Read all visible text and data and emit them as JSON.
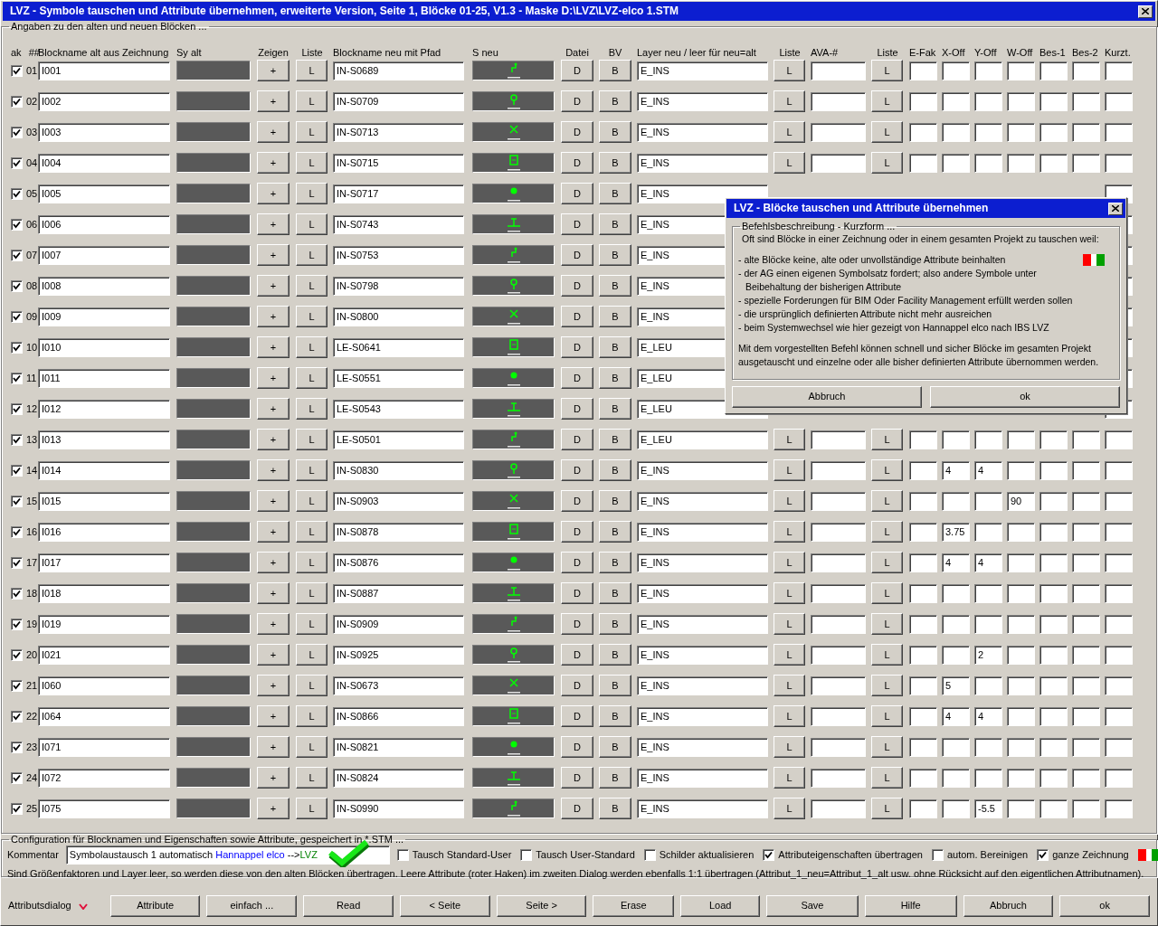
{
  "window": {
    "title": "LVZ - Symbole tauschen und Attribute übernehmen, erweiterte Version, Seite 1, Blöcke 01-25, V1.3 - Maske D:\\LVZ\\LVZ-elco 1.STM"
  },
  "blocks": {
    "legend": "Angaben zu den alten und neuen Blöcken ...",
    "columns": [
      "ak",
      "##",
      "Blockname alt aus Zeichnung",
      "Sy alt",
      "Zeigen",
      "Liste",
      "Blockname neu mit Pfad",
      "S neu",
      "Datei",
      "BV",
      "Layer neu / leer für neu=alt",
      "Liste",
      "AVA-#",
      "Liste",
      "E-Fak",
      "X-Off",
      "Y-Off",
      "W-Off",
      "Bes-1",
      "Bes-2",
      "Kurzt."
    ],
    "rows": [
      {
        "checked": true,
        "number": "01",
        "old_name": "I001",
        "show": "+",
        "list": "L",
        "new_name": "IN-S0689",
        "file": "D",
        "bv": "B",
        "layer": "E_INS",
        "layer_list": "L",
        "ava_list": "L"
      },
      {
        "checked": true,
        "number": "02",
        "old_name": "I002",
        "show": "+",
        "list": "L",
        "new_name": "IN-S0709",
        "file": "D",
        "bv": "B",
        "layer": "E_INS",
        "layer_list": "L",
        "ava_list": "L"
      },
      {
        "checked": true,
        "number": "03",
        "old_name": "I003",
        "show": "+",
        "list": "L",
        "new_name": "IN-S0713",
        "file": "D",
        "bv": "B",
        "layer": "E_INS",
        "layer_list": "L",
        "ava_list": "L"
      },
      {
        "checked": true,
        "number": "04",
        "old_name": "I004",
        "show": "+",
        "list": "L",
        "new_name": "IN-S0715",
        "file": "D",
        "bv": "B",
        "layer": "E_INS",
        "layer_list": "L",
        "ava_list": "L"
      },
      {
        "checked": true,
        "number": "05",
        "old_name": "I005",
        "show": "+",
        "list": "L",
        "new_name": "IN-S0717",
        "file": "D",
        "bv": "B",
        "layer": "E_INS"
      },
      {
        "checked": true,
        "number": "06",
        "old_name": "I006",
        "show": "+",
        "list": "L",
        "new_name": "IN-S0743",
        "file": "D",
        "bv": "B",
        "layer": "E_INS"
      },
      {
        "checked": true,
        "number": "07",
        "old_name": "I007",
        "show": "+",
        "list": "L",
        "new_name": "IN-S0753",
        "file": "D",
        "bv": "B",
        "layer": "E_INS"
      },
      {
        "checked": true,
        "number": "08",
        "old_name": "I008",
        "show": "+",
        "list": "L",
        "new_name": "IN-S0798",
        "file": "D",
        "bv": "B",
        "layer": "E_INS"
      },
      {
        "checked": true,
        "number": "09",
        "old_name": "I009",
        "show": "+",
        "list": "L",
        "new_name": "IN-S0800",
        "file": "D",
        "bv": "B",
        "layer": "E_INS"
      },
      {
        "checked": true,
        "number": "10",
        "old_name": "I010",
        "show": "+",
        "list": "L",
        "new_name": "LE-S0641",
        "file": "D",
        "bv": "B",
        "layer": "E_LEU"
      },
      {
        "checked": true,
        "number": "11",
        "old_name": "I011",
        "show": "+",
        "list": "L",
        "new_name": "LE-S0551",
        "file": "D",
        "bv": "B",
        "layer": "E_LEU"
      },
      {
        "checked": true,
        "number": "12",
        "old_name": "I012",
        "show": "+",
        "list": "L",
        "new_name": "LE-S0543",
        "file": "D",
        "bv": "B",
        "layer": "E_LEU"
      },
      {
        "checked": true,
        "number": "13",
        "old_name": "I013",
        "show": "+",
        "list": "L",
        "new_name": "LE-S0501",
        "file": "D",
        "bv": "B",
        "layer": "E_LEU",
        "layer_list": "L",
        "ava_list": "L"
      },
      {
        "checked": true,
        "number": "14",
        "old_name": "I014",
        "show": "+",
        "list": "L",
        "new_name": "IN-S0830",
        "file": "D",
        "bv": "B",
        "layer": "E_INS",
        "layer_list": "L",
        "ava_list": "L",
        "x_off": "4",
        "y_off": "4"
      },
      {
        "checked": true,
        "number": "15",
        "old_name": "I015",
        "show": "+",
        "list": "L",
        "new_name": "IN-S0903",
        "file": "D",
        "bv": "B",
        "layer": "E_INS",
        "layer_list": "L",
        "ava_list": "L",
        "w_off": "90"
      },
      {
        "checked": true,
        "number": "16",
        "old_name": "I016",
        "show": "+",
        "list": "L",
        "new_name": "IN-S0878",
        "file": "D",
        "bv": "B",
        "layer": "E_INS",
        "layer_list": "L",
        "ava_list": "L",
        "x_off": "3.75"
      },
      {
        "checked": true,
        "number": "17",
        "old_name": "I017",
        "show": "+",
        "list": "L",
        "new_name": "IN-S0876",
        "file": "D",
        "bv": "B",
        "layer": "E_INS",
        "layer_list": "L",
        "ava_list": "L",
        "x_off": "4",
        "y_off": "4"
      },
      {
        "checked": true,
        "number": "18",
        "old_name": "I018",
        "show": "+",
        "list": "L",
        "new_name": "IN-S0887",
        "file": "D",
        "bv": "B",
        "layer": "E_INS",
        "layer_list": "L",
        "ava_list": "L"
      },
      {
        "checked": true,
        "number": "19",
        "old_name": "I019",
        "show": "+",
        "list": "L",
        "new_name": "IN-S0909",
        "file": "D",
        "bv": "B",
        "layer": "E_INS",
        "layer_list": "L",
        "ava_list": "L"
      },
      {
        "checked": true,
        "number": "20",
        "old_name": "I021",
        "show": "+",
        "list": "L",
        "new_name": "IN-S0925",
        "file": "D",
        "bv": "B",
        "layer": "E_INS",
        "layer_list": "L",
        "ava_list": "L",
        "y_off": "2"
      },
      {
        "checked": true,
        "number": "21",
        "old_name": "I060",
        "show": "+",
        "list": "L",
        "new_name": "IN-S0673",
        "file": "D",
        "bv": "B",
        "layer": "E_INS",
        "layer_list": "L",
        "ava_list": "L",
        "x_off": "5"
      },
      {
        "checked": true,
        "number": "22",
        "old_name": "I064",
        "show": "+",
        "list": "L",
        "new_name": "IN-S0866",
        "file": "D",
        "bv": "B",
        "layer": "E_INS",
        "layer_list": "L",
        "ava_list": "L",
        "x_off": "4",
        "y_off": "4"
      },
      {
        "checked": true,
        "number": "23",
        "old_name": "I071",
        "show": "+",
        "list": "L",
        "new_name": "IN-S0821",
        "file": "D",
        "bv": "B",
        "layer": "E_INS",
        "layer_list": "L",
        "ava_list": "L"
      },
      {
        "checked": true,
        "number": "24",
        "old_name": "I072",
        "show": "+",
        "list": "L",
        "new_name": "IN-S0824",
        "file": "D",
        "bv": "B",
        "layer": "E_INS",
        "layer_list": "L",
        "ava_list": "L"
      },
      {
        "checked": true,
        "number": "25",
        "old_name": "I075",
        "show": "+",
        "list": "L",
        "new_name": "IN-S0990",
        "file": "D",
        "bv": "B",
        "layer": "E_INS",
        "layer_list": "L",
        "ava_list": "L",
        "y_off": "-5.5"
      }
    ]
  },
  "config": {
    "legend": "Configuration für Blocknamen und Eigenschaften sowie Attribute, gespeichert in *.STM ...",
    "comment_label": "Kommentar",
    "comment": [
      {
        "text": "Symbolaustausch 1 automatisch "
      },
      {
        "text": "Hannappel elco",
        "color": "#0000ff"
      },
      {
        "text": " -->"
      },
      {
        "text": "LVZ",
        "color": "#008000"
      }
    ],
    "options": [
      {
        "label": "Tausch Standard-User",
        "checked": false
      },
      {
        "label": "Tausch User-Standard",
        "checked": false
      },
      {
        "label": "Schilder aktualisieren",
        "checked": false
      },
      {
        "label": "Attributeigenschaften übertragen",
        "checked": true
      },
      {
        "label": "autom. Bereinigen",
        "checked": false
      },
      {
        "label": "ganze Zeichnung",
        "checked": true
      }
    ],
    "note": "Sind Größenfaktoren und Layer leer, so werden diese von den alten Blöcken übertragen. Leere Attribute (roter Haken) im zweiten Dialog werden ebenfalls 1:1 übertragen (Attribut_1_neu=Attribut_1_alt usw. ohne Rücksicht auf den eigentlichen Attributnamen)."
  },
  "footer": {
    "label": "Attributsdialog",
    "buttons": [
      "Attribute",
      "einfach ...",
      "Read",
      "< Seite",
      "Seite >",
      "Erase",
      "Load",
      "Save",
      "Hilfe",
      "Abbruch",
      "ok"
    ]
  },
  "dialog": {
    "title": "LVZ - Blöcke tauschen und Attribute übernehmen",
    "legend": "Befehlsbeschreibung - Kurzform ...",
    "intro": "Oft sind Blöcke in einer Zeichnung oder in einem gesamten Projekt zu tauschen weil:",
    "reasons": [
      "- alte Blöcke keine, alte oder unvollständige Attribute beinhalten",
      "- der AG einen eigenen Symbolsatz fordert; also andere Symbole unter",
      "Beibehaltung der bisherigen Attribute",
      "- spezielle Forderungen für BIM Oder Facility Management erfüllt werden sollen",
      "- die ursprünglich definierten Attribute nicht mehr ausreichen",
      "- beim Systemwechsel wie hier gezeigt von Hannappel elco nach IBS LVZ"
    ],
    "summary": "Mit dem vorgestellten Befehl können schnell und sicher Blöcke im gesamten Projekt ausgetauscht und einzelne oder alle bisher definierten Attribute übernommen werden.",
    "buttons": [
      "Abbruch",
      "ok"
    ]
  }
}
